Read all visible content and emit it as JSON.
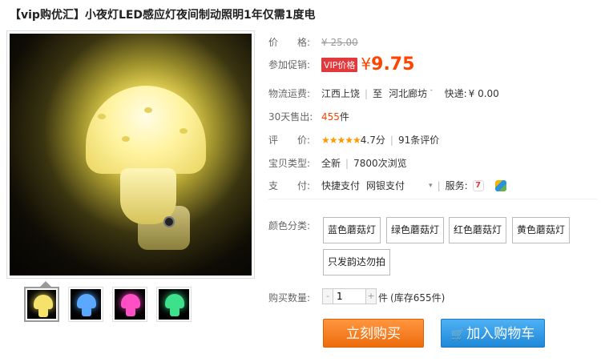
{
  "title": "【vip购优汇】小夜灯LED感应灯夜间制动照明1年仅需1度电",
  "price": {
    "label": "价　　格:",
    "original": "¥ 25.00"
  },
  "promo": {
    "label": "参加促销:",
    "badge": "VIP价格",
    "currency": "¥",
    "amount": "9.75"
  },
  "shipping": {
    "label": "物流运费:",
    "from": "江西上饶",
    "to_word": "至",
    "to": "河北廊坊",
    "express_label": "快递:",
    "express_fee": "¥ 0.00"
  },
  "sold": {
    "label": "30天售出:",
    "count": "455",
    "unit": "件"
  },
  "rating": {
    "label": "评　　价:",
    "stars": "★★★★★",
    "score": "4.7分",
    "reviews": "91条评价"
  },
  "type": {
    "label": "宝贝类型:",
    "value": "全新",
    "views": "7800次浏览"
  },
  "payment": {
    "label": "支　　付:",
    "method1": "快捷支付",
    "method2": "网银支付",
    "service_label": "服务:"
  },
  "colors": {
    "label": "颜色分类:",
    "options": [
      "蓝色蘑菇灯",
      "绿色蘑菇灯",
      "红色蘑菇灯",
      "黄色蘑菇灯",
      "只发韵达勿拍"
    ]
  },
  "quantity": {
    "label": "购买数量:",
    "minus": "-",
    "value": "1",
    "plus": "+",
    "unit": "件",
    "stock": "(库存655件)"
  },
  "buttons": {
    "buy": "立刻购买",
    "cart": "加入购物车"
  },
  "thumbnails": [
    {
      "color": "#f5e26a",
      "name": "yellow"
    },
    {
      "color": "#5aa8ff",
      "name": "blue"
    },
    {
      "color": "#ff4fc4",
      "name": "pink"
    },
    {
      "color": "#3fe08c",
      "name": "green"
    }
  ],
  "colors_theme": {
    "accent": "#ff4400",
    "buy": "#f37b1d",
    "cart": "#2a93e0"
  }
}
